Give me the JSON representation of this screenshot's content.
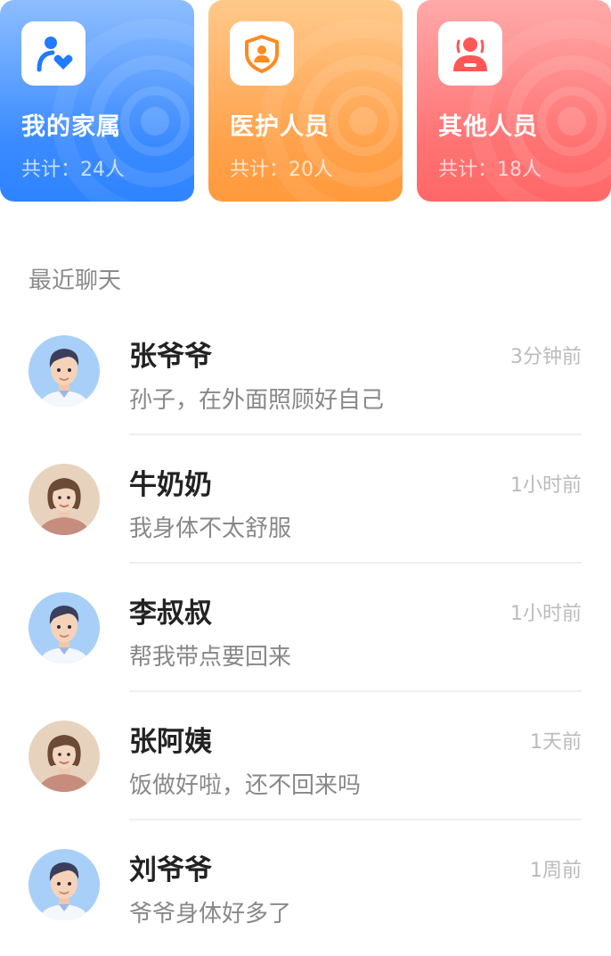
{
  "categories": [
    {
      "title": "我的家属",
      "count": "共计：24人",
      "icon": "family-user-heart-icon",
      "color": "#3b8bff"
    },
    {
      "title": "医护人员",
      "count": "共计：20人",
      "icon": "shield-user-icon",
      "color": "#ff9f45"
    },
    {
      "title": "其他人员",
      "count": "共计：18人",
      "icon": "staff-badge-icon",
      "color": "#ff6f6f"
    }
  ],
  "recent": {
    "title": "最近聊天",
    "items": [
      {
        "name": "张爷爷",
        "time": "3分钟前",
        "message": "孙子，在外面照顾好自己",
        "avatar": "male-avatar"
      },
      {
        "name": "牛奶奶",
        "time": "1小时前",
        "message": "我身体不太舒服",
        "avatar": "female-avatar"
      },
      {
        "name": "李叔叔",
        "time": "1小时前",
        "message": "帮我带点要回来",
        "avatar": "male-avatar"
      },
      {
        "name": "张阿姨",
        "time": "1天前",
        "message": "饭做好啦，还不回来吗",
        "avatar": "female-avatar"
      },
      {
        "name": "刘爷爷",
        "time": "1周前",
        "message": "爷爷身体好多了",
        "avatar": "male-avatar"
      }
    ]
  }
}
